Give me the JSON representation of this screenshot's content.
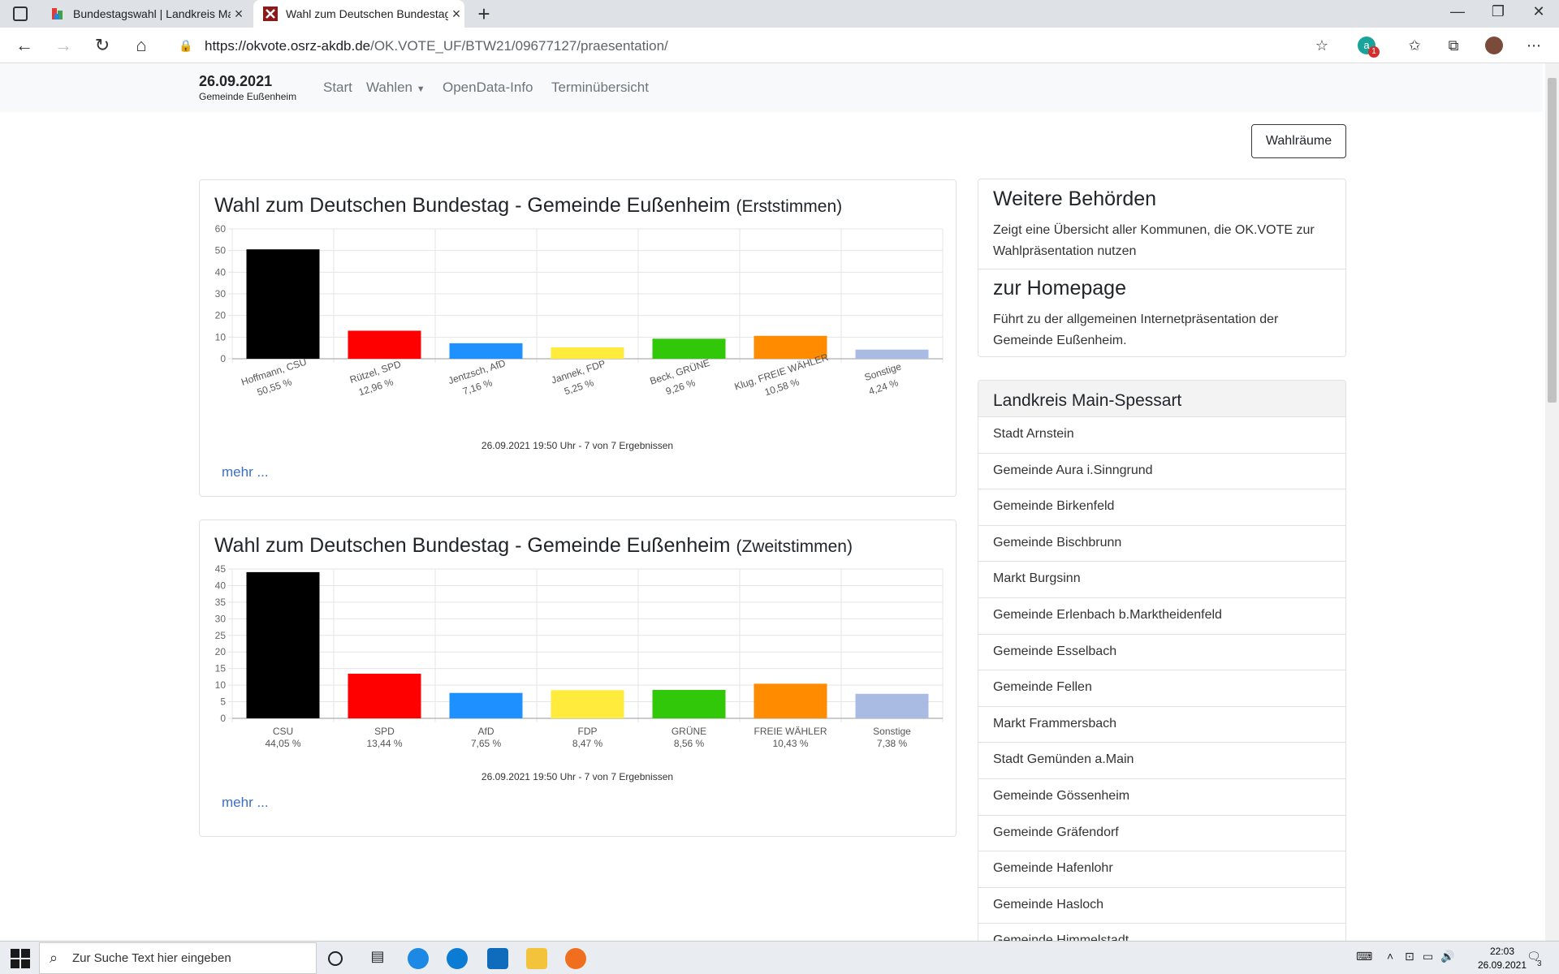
{
  "browser": {
    "tabs": [
      {
        "title": "Bundestagswahl | Landkreis Main",
        "active": false
      },
      {
        "title": "Wahl zum Deutschen Bundestag",
        "active": true
      }
    ],
    "url_host": "https://okvote.osrz-akdb.de",
    "url_path": "/OK.VOTE_UF/BTW21/09677127/praesentation/",
    "extension_badge": "1"
  },
  "navbar": {
    "date": "26.09.2021",
    "municipality": "Gemeinde Eußenheim",
    "links": [
      "Start",
      "Wahlen",
      "OpenData-Info",
      "Terminübersicht"
    ]
  },
  "buttons": {
    "wahlraeume": "Wahlräume"
  },
  "charts": [
    {
      "title": "Wahl zum Deutschen Bundestag - Gemeinde Eußenheim",
      "subtitle": "(Erststimmen)",
      "stamp": "26.09.2021 19:50 Uhr - 7 von 7 Ergebnissen",
      "more": "mehr ..."
    },
    {
      "title": "Wahl zum Deutschen Bundestag - Gemeinde Eußenheim",
      "subtitle": "(Zweitstimmen)",
      "stamp": "26.09.2021 19:50 Uhr - 7 von 7 Ergebnissen",
      "more": "mehr ..."
    }
  ],
  "chart_data": [
    {
      "type": "bar",
      "categories": [
        "Hoffmann, CSU",
        "Rützel, SPD",
        "Jentzsch, AfD",
        "Jannek, FDP",
        "Beck, GRÜNE",
        "Klug, FREIE WÄHLER",
        "Sonstige"
      ],
      "labels": [
        "50,55 %",
        "12,96 %",
        "7,16 %",
        "5,25 %",
        "9,26 %",
        "10,58 %",
        "4,24 %"
      ],
      "values": [
        50.55,
        12.96,
        7.16,
        5.25,
        9.26,
        10.58,
        4.24
      ],
      "colors": [
        "#000000",
        "#ff0000",
        "#1e90ff",
        "#ffeb3b",
        "#32c80a",
        "#ff8c00",
        "#aabbe3"
      ],
      "ylim": [
        0,
        60
      ],
      "yticks": [
        0,
        10,
        20,
        30,
        40,
        50,
        60
      ],
      "rotated_labels": true,
      "grid": true
    },
    {
      "type": "bar",
      "categories": [
        "CSU",
        "SPD",
        "AfD",
        "FDP",
        "GRÜNE",
        "FREIE WÄHLER",
        "Sonstige"
      ],
      "labels": [
        "44,05 %",
        "13,44 %",
        "7,65 %",
        "8,47 %",
        "8,56 %",
        "10,43 %",
        "7,38 %"
      ],
      "values": [
        44.05,
        13.44,
        7.65,
        8.47,
        8.56,
        10.43,
        7.38
      ],
      "colors": [
        "#000000",
        "#ff0000",
        "#1e90ff",
        "#ffeb3b",
        "#32c80a",
        "#ff8c00",
        "#aabbe3"
      ],
      "ylim": [
        0,
        45
      ],
      "yticks": [
        0,
        5,
        10,
        15,
        20,
        25,
        30,
        35,
        40,
        45
      ],
      "rotated_labels": false,
      "grid": true
    }
  ],
  "sidebar": {
    "info": [
      {
        "title": "Weitere Behörden",
        "text": "Zeigt eine Übersicht aller Kommunen, die OK.VOTE zur Wahlpräsentation nutzen"
      },
      {
        "title": "zur Homepage",
        "text": "Führt zu der allgemeinen Internetpräsentation der Gemeinde Eußenheim."
      }
    ],
    "list_title": "Landkreis Main-Spessart",
    "list": [
      "Stadt Arnstein",
      "Gemeinde Aura i.Sinngrund",
      "Gemeinde Birkenfeld",
      "Gemeinde Bischbrunn",
      "Markt Burgsinn",
      "Gemeinde Erlenbach b.Marktheidenfeld",
      "Gemeinde Esselbach",
      "Gemeinde Fellen",
      "Markt Frammersbach",
      "Stadt Gemünden a.Main",
      "Gemeinde Gössenheim",
      "Gemeinde Gräfendorf",
      "Gemeinde Hafenlohr",
      "Gemeinde Hasloch",
      "Gemeinde Himmelstadt"
    ]
  },
  "taskbar": {
    "search_placeholder": "Zur Suche Text hier eingeben",
    "time": "22:03",
    "date": "26.09.2021",
    "notification_count": "3"
  }
}
